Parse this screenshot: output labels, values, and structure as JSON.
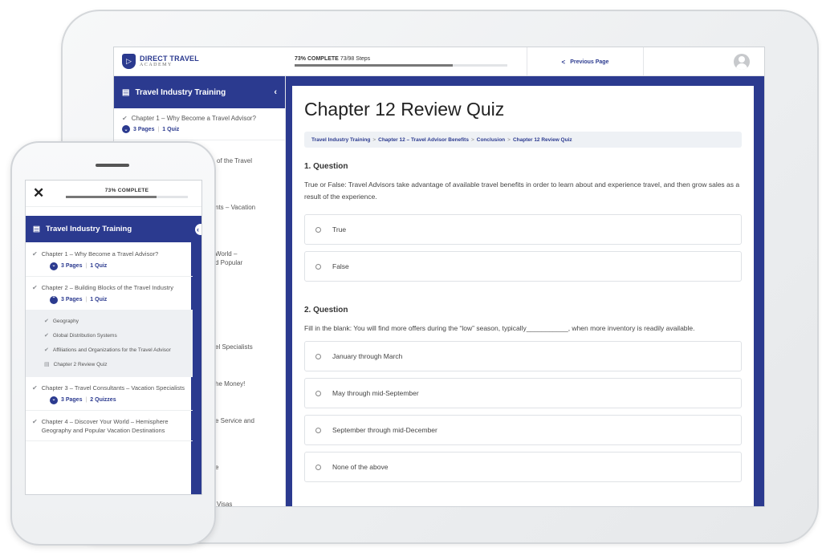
{
  "tablet": {
    "logo": {
      "title": "DIRECT TRAVEL",
      "subtitle": "ACADEMY"
    },
    "progress": {
      "percent_label": "73% COMPLETE",
      "steps_label": "73/98 Steps",
      "fraction": 0.745
    },
    "prev_page_label": "Previous Page",
    "sidebar": {
      "title": "Travel Industry Training",
      "items": [
        {
          "label": "Chapter 1 – Why Become a Travel Advisor?",
          "pages": "3 Pages",
          "quiz": "1 Quiz"
        }
      ],
      "peeks": [
        "of the Travel",
        "nts – Vacation",
        "World –",
        "d Popular",
        "el Specialists",
        "he Money!",
        "e Service and",
        "e",
        "Visas"
      ]
    },
    "main": {
      "title": "Chapter 12 Review Quiz",
      "breadcrumb": [
        "Travel Industry Training",
        "Chapter 12 – Travel Advisor Benefits",
        "Conclusion",
        "Chapter 12 Review Quiz"
      ],
      "questions": [
        {
          "heading": "1. Question",
          "text": "True or False: Travel Advisors take advantage of available travel benefits in order to learn about and experience travel, and then grow sales as a result of the experience.",
          "answers": [
            "True",
            "False"
          ]
        },
        {
          "heading": "2. Question",
          "text": "Fill in the blank: You will find more offers during the “low” season, typically___________, when more inventory is readily available.",
          "answers": [
            "January through March",
            "May through mid-September",
            "September through mid-December",
            "None of the above"
          ]
        }
      ]
    }
  },
  "phone": {
    "progress_label": "73% COMPLETE",
    "progress_fraction": 0.745,
    "header_title": "Travel Industry Training",
    "items": [
      {
        "label": "Chapter 1 – Why Become a Travel Advisor?",
        "pages": "3 Pages",
        "quiz": "1 Quiz"
      },
      {
        "label": "Chapter 2 – Building Blocks of the Travel Industry",
        "pages": "3 Pages",
        "quiz": "1 Quiz"
      },
      {
        "label": "Chapter 3 – Travel Consultants – Vacation Specialists",
        "pages": "3 Pages",
        "quiz": "2 Quizzes"
      },
      {
        "label": "Chapter 4 – Discover Your World – Hemisphere Geography and Popular Vacation Destinations"
      }
    ],
    "subitems": [
      "Geography",
      "Global Distribution Systems",
      "Affiliations and Organizations for the Travel Advisor",
      "Chapter 2 Review Quiz"
    ]
  }
}
